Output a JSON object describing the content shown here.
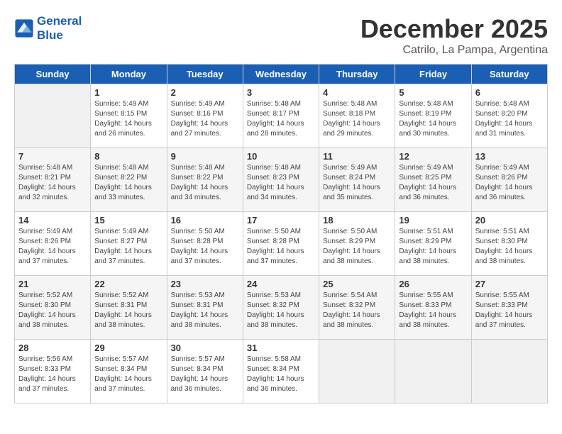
{
  "header": {
    "logo_line1": "General",
    "logo_line2": "Blue",
    "month": "December 2025",
    "location": "Catrilo, La Pampa, Argentina"
  },
  "weekdays": [
    "Sunday",
    "Monday",
    "Tuesday",
    "Wednesday",
    "Thursday",
    "Friday",
    "Saturday"
  ],
  "weeks": [
    [
      {
        "day": "",
        "empty": true
      },
      {
        "day": "1",
        "sunrise": "5:49 AM",
        "sunset": "8:15 PM",
        "daylight": "14 hours and 26 minutes."
      },
      {
        "day": "2",
        "sunrise": "5:49 AM",
        "sunset": "8:16 PM",
        "daylight": "14 hours and 27 minutes."
      },
      {
        "day": "3",
        "sunrise": "5:48 AM",
        "sunset": "8:17 PM",
        "daylight": "14 hours and 28 minutes."
      },
      {
        "day": "4",
        "sunrise": "5:48 AM",
        "sunset": "8:18 PM",
        "daylight": "14 hours and 29 minutes."
      },
      {
        "day": "5",
        "sunrise": "5:48 AM",
        "sunset": "8:19 PM",
        "daylight": "14 hours and 30 minutes."
      },
      {
        "day": "6",
        "sunrise": "5:48 AM",
        "sunset": "8:20 PM",
        "daylight": "14 hours and 31 minutes."
      }
    ],
    [
      {
        "day": "7",
        "sunrise": "5:48 AM",
        "sunset": "8:21 PM",
        "daylight": "14 hours and 32 minutes."
      },
      {
        "day": "8",
        "sunrise": "5:48 AM",
        "sunset": "8:22 PM",
        "daylight": "14 hours and 33 minutes."
      },
      {
        "day": "9",
        "sunrise": "5:48 AM",
        "sunset": "8:22 PM",
        "daylight": "14 hours and 34 minutes."
      },
      {
        "day": "10",
        "sunrise": "5:48 AM",
        "sunset": "8:23 PM",
        "daylight": "14 hours and 34 minutes."
      },
      {
        "day": "11",
        "sunrise": "5:49 AM",
        "sunset": "8:24 PM",
        "daylight": "14 hours and 35 minutes."
      },
      {
        "day": "12",
        "sunrise": "5:49 AM",
        "sunset": "8:25 PM",
        "daylight": "14 hours and 36 minutes."
      },
      {
        "day": "13",
        "sunrise": "5:49 AM",
        "sunset": "8:26 PM",
        "daylight": "14 hours and 36 minutes."
      }
    ],
    [
      {
        "day": "14",
        "sunrise": "5:49 AM",
        "sunset": "8:26 PM",
        "daylight": "14 hours and 37 minutes."
      },
      {
        "day": "15",
        "sunrise": "5:49 AM",
        "sunset": "8:27 PM",
        "daylight": "14 hours and 37 minutes."
      },
      {
        "day": "16",
        "sunrise": "5:50 AM",
        "sunset": "8:28 PM",
        "daylight": "14 hours and 37 minutes."
      },
      {
        "day": "17",
        "sunrise": "5:50 AM",
        "sunset": "8:28 PM",
        "daylight": "14 hours and 37 minutes."
      },
      {
        "day": "18",
        "sunrise": "5:50 AM",
        "sunset": "8:29 PM",
        "daylight": "14 hours and 38 minutes."
      },
      {
        "day": "19",
        "sunrise": "5:51 AM",
        "sunset": "8:29 PM",
        "daylight": "14 hours and 38 minutes."
      },
      {
        "day": "20",
        "sunrise": "5:51 AM",
        "sunset": "8:30 PM",
        "daylight": "14 hours and 38 minutes."
      }
    ],
    [
      {
        "day": "21",
        "sunrise": "5:52 AM",
        "sunset": "8:30 PM",
        "daylight": "14 hours and 38 minutes."
      },
      {
        "day": "22",
        "sunrise": "5:52 AM",
        "sunset": "8:31 PM",
        "daylight": "14 hours and 38 minutes."
      },
      {
        "day": "23",
        "sunrise": "5:53 AM",
        "sunset": "8:31 PM",
        "daylight": "14 hours and 38 minutes."
      },
      {
        "day": "24",
        "sunrise": "5:53 AM",
        "sunset": "8:32 PM",
        "daylight": "14 hours and 38 minutes."
      },
      {
        "day": "25",
        "sunrise": "5:54 AM",
        "sunset": "8:32 PM",
        "daylight": "14 hours and 38 minutes."
      },
      {
        "day": "26",
        "sunrise": "5:55 AM",
        "sunset": "8:33 PM",
        "daylight": "14 hours and 38 minutes."
      },
      {
        "day": "27",
        "sunrise": "5:55 AM",
        "sunset": "8:33 PM",
        "daylight": "14 hours and 37 minutes."
      }
    ],
    [
      {
        "day": "28",
        "sunrise": "5:56 AM",
        "sunset": "8:33 PM",
        "daylight": "14 hours and 37 minutes."
      },
      {
        "day": "29",
        "sunrise": "5:57 AM",
        "sunset": "8:34 PM",
        "daylight": "14 hours and 37 minutes."
      },
      {
        "day": "30",
        "sunrise": "5:57 AM",
        "sunset": "8:34 PM",
        "daylight": "14 hours and 36 minutes."
      },
      {
        "day": "31",
        "sunrise": "5:58 AM",
        "sunset": "8:34 PM",
        "daylight": "14 hours and 36 minutes."
      },
      {
        "day": "",
        "empty": true
      },
      {
        "day": "",
        "empty": true
      },
      {
        "day": "",
        "empty": true
      }
    ]
  ]
}
